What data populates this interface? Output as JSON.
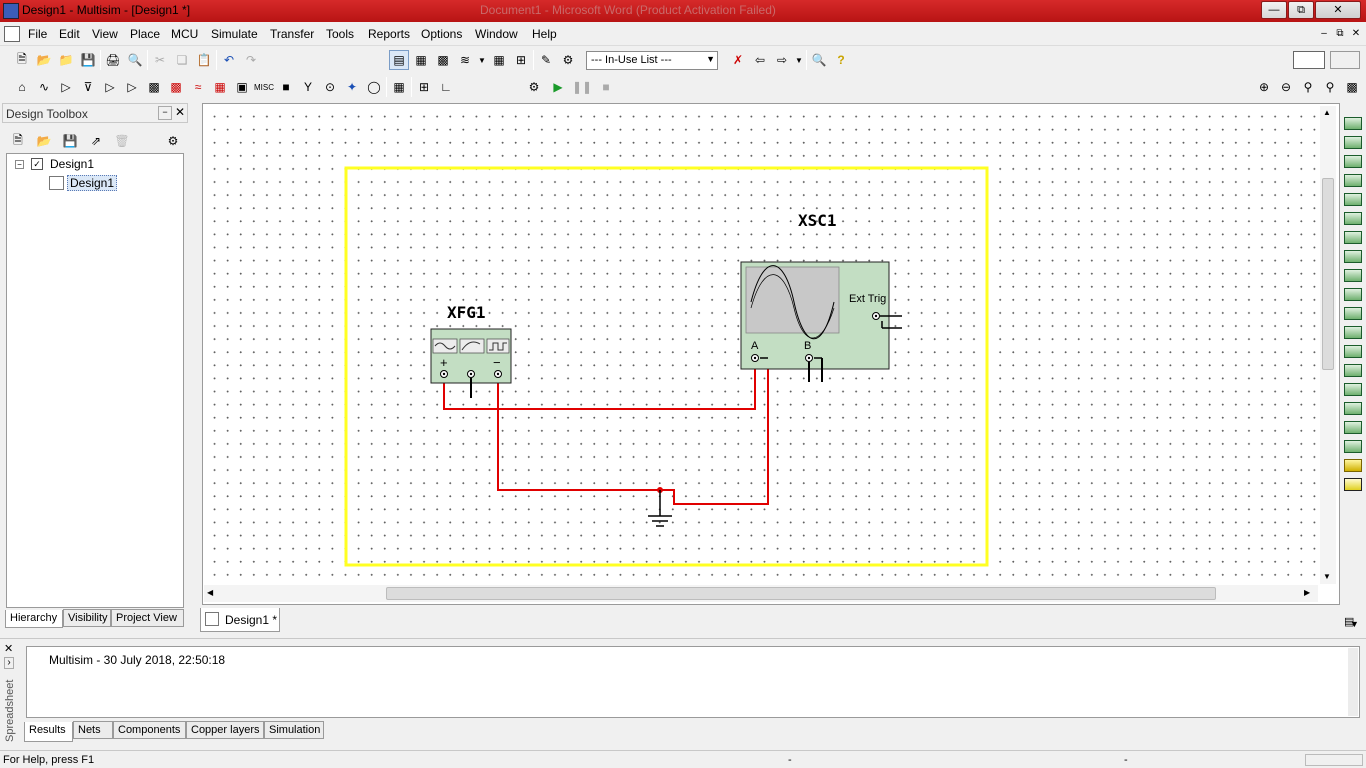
{
  "window": {
    "title": "Design1 - Multisim - [Design1 *]",
    "background_title": "Document1 - Microsoft Word (Product Activation Failed)"
  },
  "menu": {
    "items": [
      "File",
      "Edit",
      "View",
      "Place",
      "MCU",
      "Simulate",
      "Transfer",
      "Tools",
      "Reports",
      "Options",
      "Window",
      "Help"
    ]
  },
  "toolbar": {
    "in_use_list": "--- In-Use List ---"
  },
  "toolbox": {
    "title": "Design Toolbox",
    "tree": {
      "root": "Design1",
      "child": "Design1"
    },
    "tabs": [
      "Hierarchy",
      "Visibility",
      "Project View"
    ]
  },
  "schematic": {
    "function_generator_label": "XFG1",
    "oscilloscope_label": "XSC1",
    "fg_terminals": [
      "+",
      "−"
    ],
    "osc_ext_trig": "Ext Trig",
    "osc_channels": [
      "A",
      "B"
    ],
    "wire_color": "#e00000",
    "border_color": "#ffff00",
    "instrument_color": "#c3dec3"
  },
  "document_tab": "Design1 *",
  "spreadsheet": {
    "side_label": "Spreadsheet",
    "log_line": "Multisim  -  30 July 2018, 22:50:18",
    "tabs": [
      "Results",
      "Nets",
      "Components",
      "Copper layers",
      "Simulation"
    ]
  },
  "statusbar": {
    "help": "For Help, press F1",
    "seg1": "-",
    "seg2": "-"
  }
}
